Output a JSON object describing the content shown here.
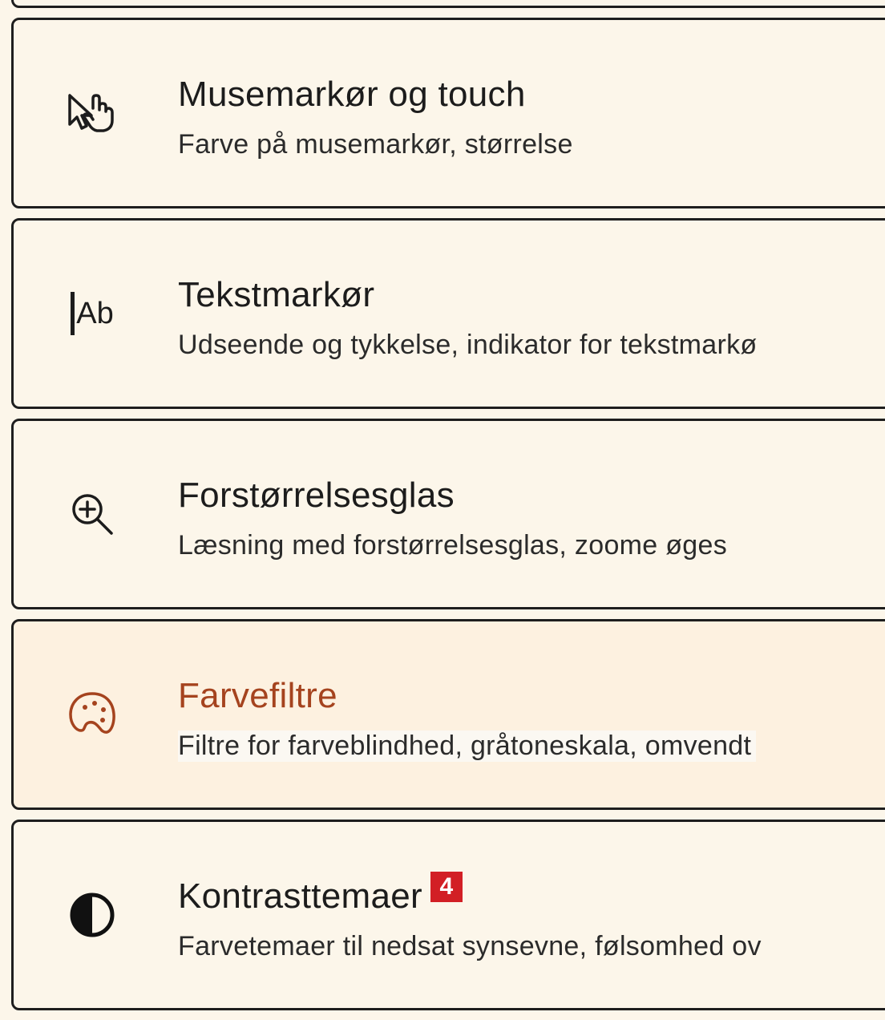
{
  "items": [
    {
      "title": "Musemarkør og touch",
      "subtitle": "Farve på musemarkør, størrelse",
      "icon": "mouse-pointer-touch-icon"
    },
    {
      "title": "Tekstmarkør",
      "subtitle": "Udseende og tykkelse, indikator for tekstmarkø",
      "icon": "text-cursor-icon",
      "icon_text": "Ab"
    },
    {
      "title": "Forstørrelsesglas",
      "subtitle": "Læsning med forstørrelsesglas, zoome øges",
      "icon": "magnifier-zoom-in-icon"
    },
    {
      "title": "Farvefiltre",
      "subtitle": "Filtre for farveblindhed, gråtoneskala, omvendt",
      "icon": "palette-icon",
      "selected": true
    },
    {
      "title": "Kontrasttemaer",
      "badge": "4",
      "subtitle": "Farvetemaer til nedsat synsevne, følsomhed ov",
      "icon": "contrast-icon"
    }
  ],
  "colors": {
    "background": "#fcf6ea",
    "selected_background": "#fdf1e0",
    "accent": "#a5431e",
    "badge": "#d21f25",
    "border": "#1e1e1e"
  }
}
